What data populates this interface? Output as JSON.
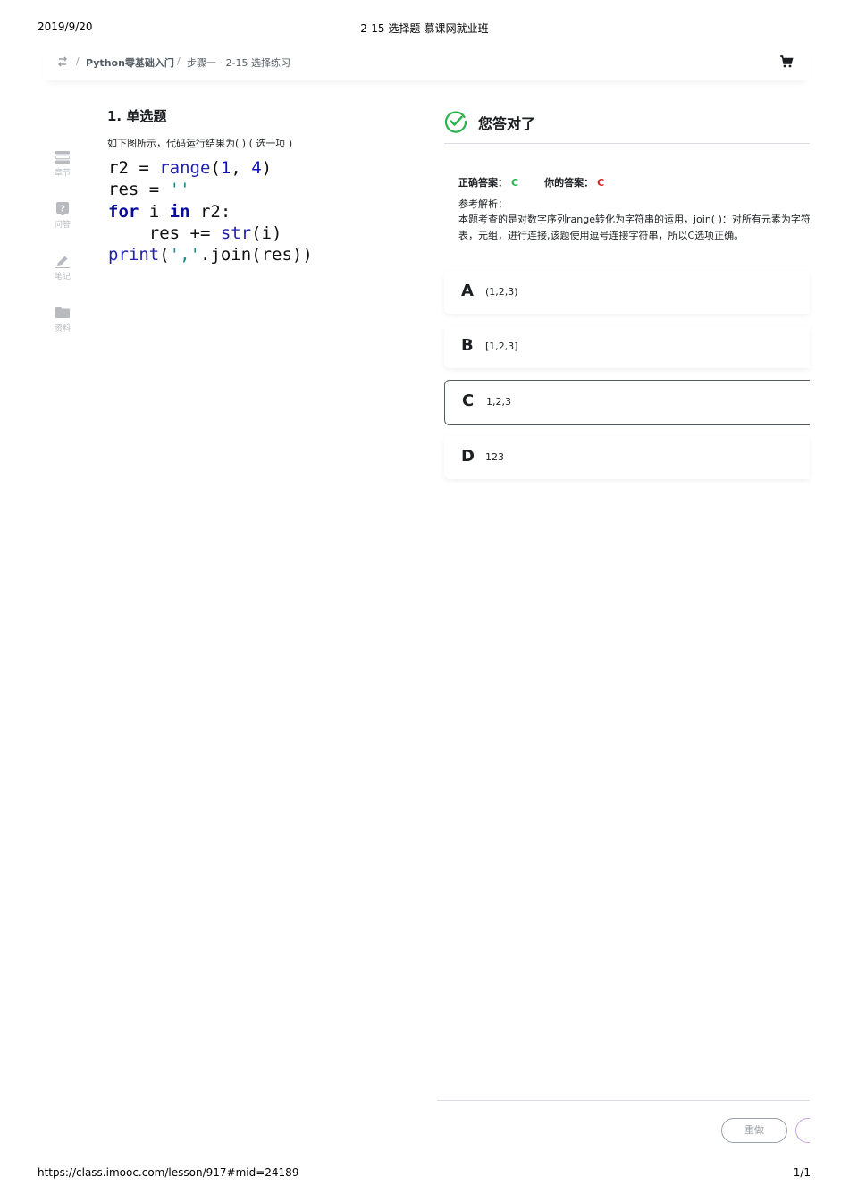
{
  "print": {
    "date": "2019/9/20",
    "title": "2-15 选择题-慕课网就业班",
    "url": "https://class.imooc.com/lesson/917#mid=24189",
    "page": "1/1"
  },
  "breadcrumb": {
    "sep": "/",
    "course": "Python零基础入门",
    "step": "步骤一 · 2-15 选择练习"
  },
  "sidebar": {
    "items": [
      {
        "label": "章节",
        "icon": "chapter-icon"
      },
      {
        "label": "问答",
        "icon": "question-icon"
      },
      {
        "label": "笔记",
        "icon": "pencil-icon"
      },
      {
        "label": "资料",
        "icon": "folder-icon"
      }
    ]
  },
  "question": {
    "title": "1. 单选题",
    "desc": "如下图所示，代码运行结果为(  ) ( 选一项 )",
    "code": {
      "l1": [
        "r2 = ",
        "range",
        "(",
        "1",
        ", ",
        "4",
        ")"
      ],
      "l2": [
        "res = ",
        "''"
      ],
      "l3": [
        "for",
        " i ",
        "in",
        " r2:"
      ],
      "l4": [
        "    res += ",
        "str",
        "(i)"
      ],
      "l5": [
        "print",
        "(",
        "','",
        ".join(res))"
      ]
    }
  },
  "result": {
    "status": "您答对了",
    "correct_label": "正确答案：",
    "correct_value": "C",
    "your_label": "你的答案：",
    "your_value": "C",
    "analysis_label": "参考解析：",
    "analysis_line1": "本题考查的是对数字序列range转化为字符串的运用，join( )：对所有元素为字符串的序列类型，如列",
    "analysis_line2": "表，元组，进行连接,该题使用逗号连接字符串，所以C选项正确。"
  },
  "options": [
    {
      "letter": "A",
      "text": "(1,2,3)",
      "selected": false
    },
    {
      "letter": "B",
      "text": "[1,2,3]",
      "selected": false
    },
    {
      "letter": "C",
      "text": "1,2,3",
      "selected": true
    },
    {
      "letter": "D",
      "text": "123",
      "selected": false
    }
  ],
  "actions": {
    "redo": "重做"
  },
  "colors": {
    "correct": "#2bb24c",
    "wrong": "#e02020",
    "accent": "#c8a2e8"
  }
}
